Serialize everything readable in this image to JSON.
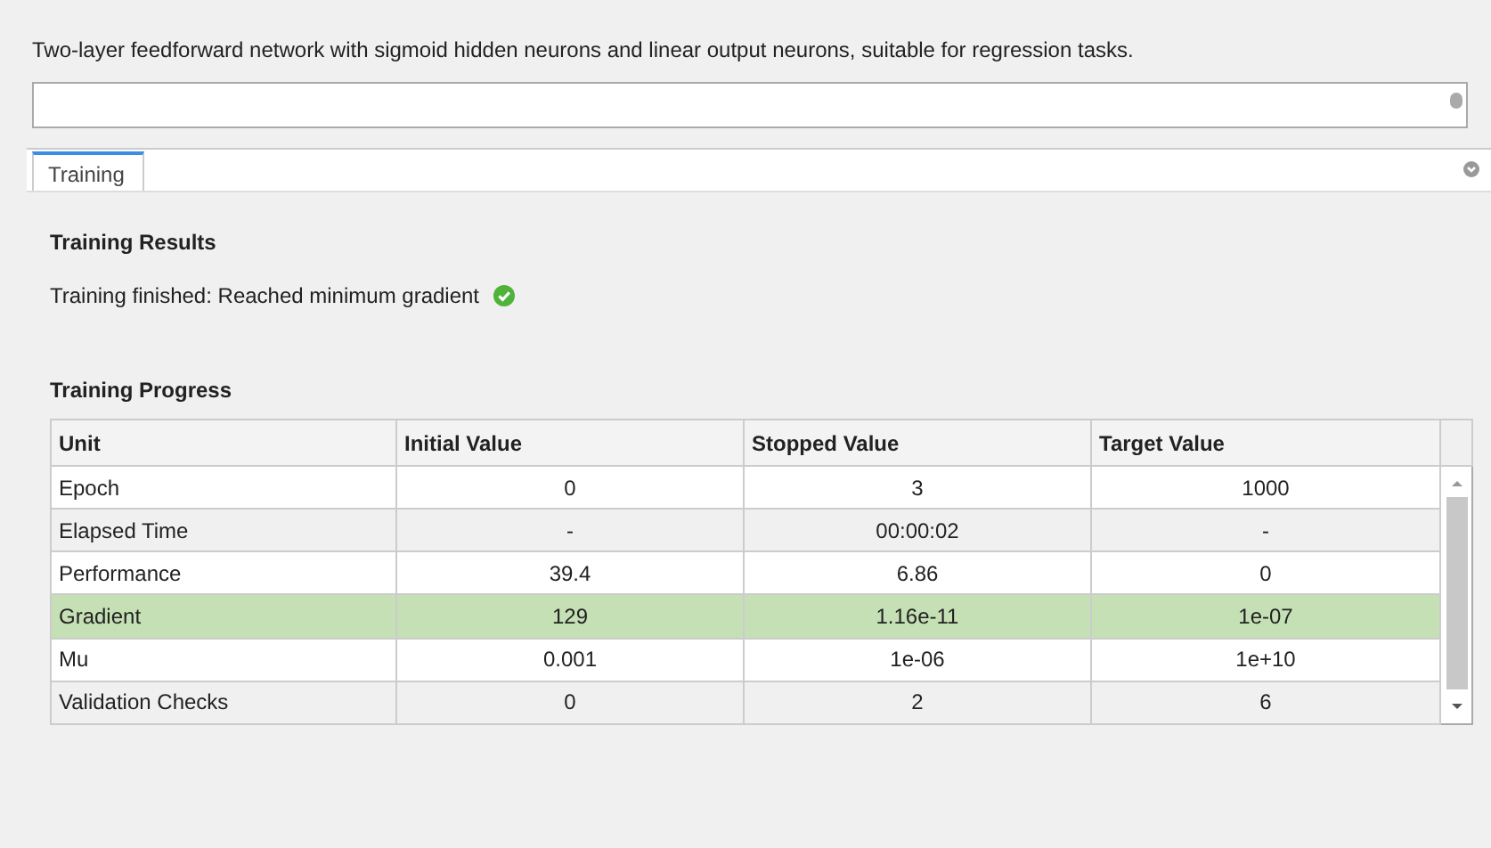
{
  "description": "Two-layer feedforward network with sigmoid hidden neurons and linear output neurons, suitable for regression tasks.",
  "tabs": [
    {
      "label": "Training",
      "selected": true
    }
  ],
  "results": {
    "title": "Training Results",
    "status": "Training finished: Reached minimum gradient",
    "success": true
  },
  "progress": {
    "title": "Training Progress",
    "columns": [
      "Unit",
      "Initial Value",
      "Stopped Value",
      "Target Value"
    ],
    "rows": [
      {
        "cells": [
          "Epoch",
          "0",
          "3",
          "1000"
        ],
        "highlighted": false
      },
      {
        "cells": [
          "Elapsed Time",
          "-",
          "00:00:02",
          "-"
        ],
        "highlighted": false
      },
      {
        "cells": [
          "Performance",
          "39.4",
          "6.86",
          "0"
        ],
        "highlighted": false
      },
      {
        "cells": [
          "Gradient",
          "129",
          "1.16e-11",
          "1e-07"
        ],
        "highlighted": true
      },
      {
        "cells": [
          "Mu",
          "0.001",
          "1e-06",
          "1e+10"
        ],
        "highlighted": false
      },
      {
        "cells": [
          "Validation Checks",
          "0",
          "2",
          "6"
        ],
        "highlighted": false
      }
    ]
  }
}
